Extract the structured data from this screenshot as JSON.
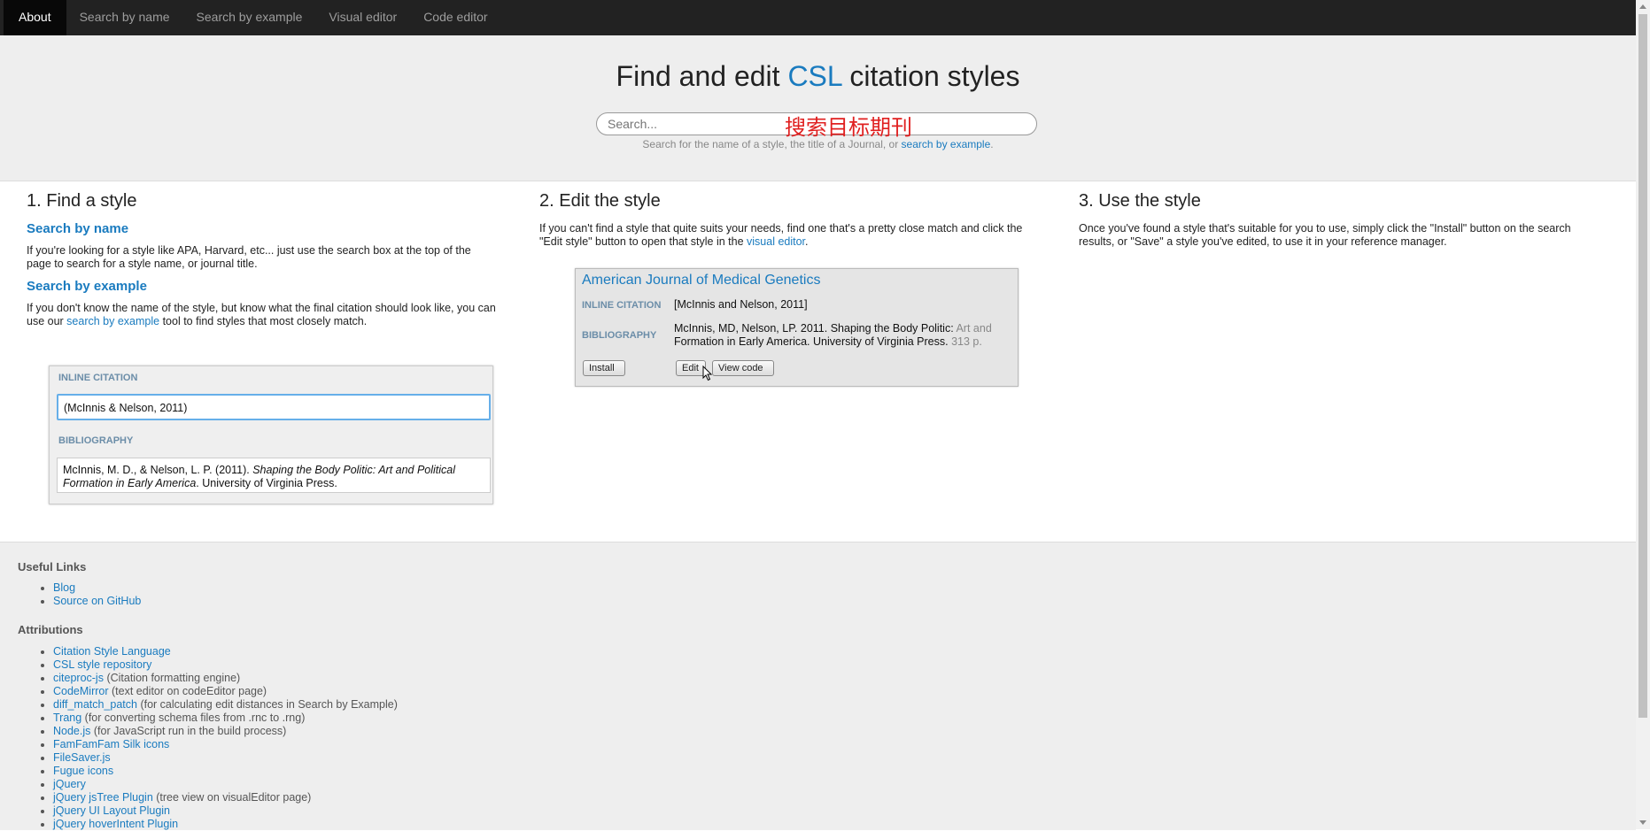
{
  "nav": {
    "items": [
      "About",
      "Search by name",
      "Search by example",
      "Visual editor",
      "Code editor"
    ]
  },
  "hero": {
    "title_pre": "Find and edit ",
    "title_csl": "CSL",
    "title_post": " citation styles",
    "search_placeholder": "Search...",
    "search_annotation": "搜索目标期刊",
    "hint_pre": "Search for the name of a style, the title of a Journal, or ",
    "hint_link": "search by example",
    "hint_post": "."
  },
  "find": {
    "heading": "1. Find a style",
    "by_name_heading": "Search by name",
    "by_name_text": "If you're looking for a style like APA, Harvard, etc... just use the search box at the top of the page to search for a style name, or journal title.",
    "by_example_heading": "Search by example",
    "by_example_pre": "If you don't know the name of the style, but know what the final citation should look like, you can use our ",
    "by_example_link": "search by example",
    "by_example_post": " tool to find styles that most closely match.",
    "example": {
      "inline_label": "INLINE CITATION",
      "inline_value": "(McInnis & Nelson, 2011)",
      "bib_label": "BIBLIOGRAPHY",
      "bib_pre": "McInnis, M. D., & Nelson, L. P. (2011). ",
      "bib_italic": "Shaping the Body Politic: Art and Political Formation in Early America",
      "bib_post": ". University of Virginia Press."
    }
  },
  "edit": {
    "heading": "2. Edit the style",
    "text_pre": "If you can't find a style that quite suits your needs, find one that's a pretty close match and click the \"Edit style\" button to open that style in the ",
    "text_link": "visual editor",
    "text_post": ".",
    "card": {
      "title": "American Journal of Medical Genetics",
      "inline_label": "INLINE CITATION",
      "inline_value": "[McInnis and Nelson, 2011]",
      "bib_label": "BIBLIOGRAPHY",
      "bib_line1_main": "McInnis, MD, Nelson, LP. 2011. Shaping the Body Politic: ",
      "bib_line1_fade": "Art and",
      "bib_line2_main": "Formation in Early America. University of Virginia Press. ",
      "bib_line2_fade": "313 p.",
      "install_label": "Install",
      "edit_label": "Edit",
      "view_code_label": "View code"
    }
  },
  "use": {
    "heading": "3. Use the style",
    "text": "Once you've found a style that's suitable for you to use, simply click the \"Install\" button on the search results, or \"Save\" a style you've edited, to use it in your reference manager."
  },
  "footer": {
    "useful_links_heading": "Useful Links",
    "useful_links": [
      {
        "link": "Blog",
        "desc": ""
      },
      {
        "link": "Source on GitHub",
        "desc": ""
      }
    ],
    "attributions_heading": "Attributions",
    "attributions": [
      {
        "link": "Citation Style Language",
        "desc": ""
      },
      {
        "link": "CSL style repository",
        "desc": ""
      },
      {
        "link": "citeproc-js",
        "desc": " (Citation formatting engine)"
      },
      {
        "link": "CodeMirror",
        "desc": " (text editor on codeEditor page)"
      },
      {
        "link": "diff_match_patch",
        "desc": " (for calculating edit distances in Search by Example)"
      },
      {
        "link": "Trang",
        "desc": " (for converting schema files from .rnc to .rng)"
      },
      {
        "link": "Node.js",
        "desc": " (for JavaScript run in the build process)"
      },
      {
        "link": "FamFamFam Silk icons",
        "desc": ""
      },
      {
        "link": "FileSaver.js",
        "desc": ""
      },
      {
        "link": "Fugue icons",
        "desc": ""
      },
      {
        "link": "jQuery",
        "desc": ""
      },
      {
        "link": "jQuery jsTree Plugin",
        "desc": " (tree view on visualEditor page)"
      },
      {
        "link": "jQuery UI Layout Plugin",
        "desc": ""
      },
      {
        "link": "jQuery hoverIntent Plugin",
        "desc": ""
      }
    ]
  },
  "colors": {
    "navbar": "#222222",
    "link": "#1a7bbf",
    "annotation": "#e02020",
    "panel": "#eeeeee"
  }
}
